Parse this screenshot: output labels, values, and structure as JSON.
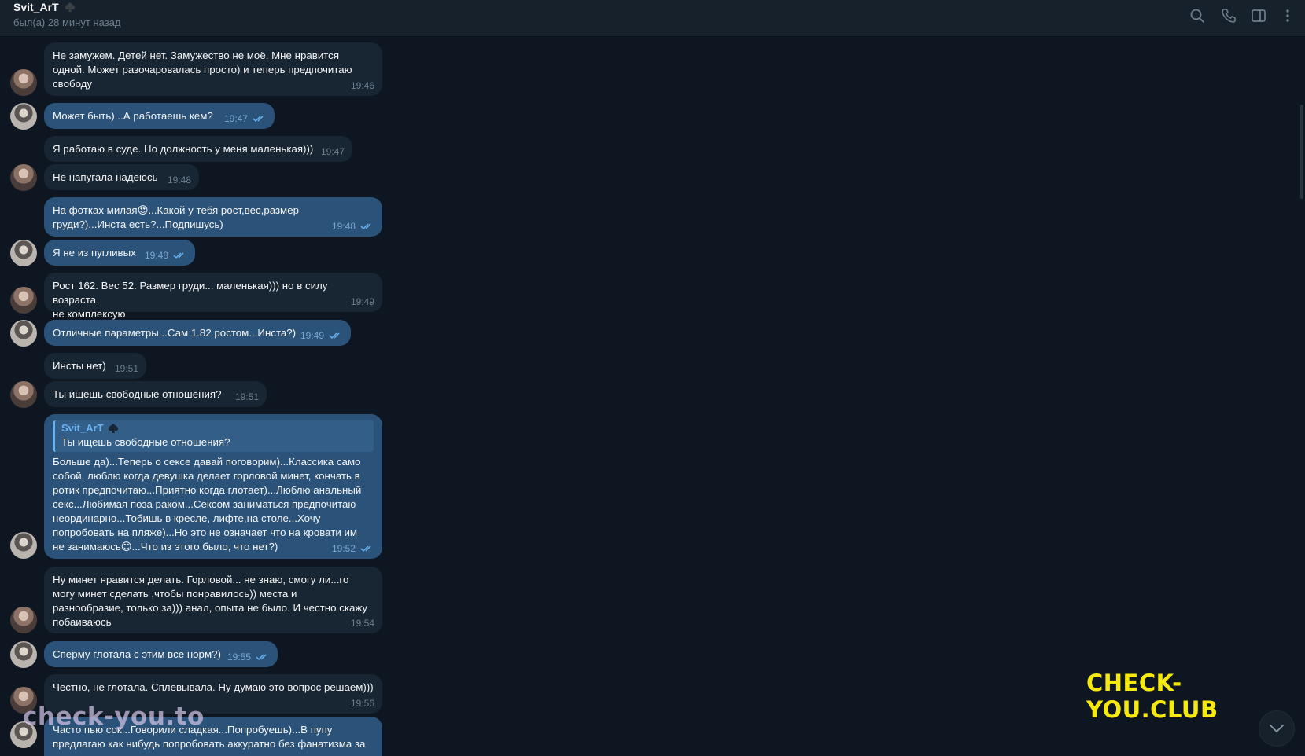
{
  "header": {
    "title": "Svit_ArT",
    "status": "был(а) 28 минут назад"
  },
  "messages": [
    {
      "dir": "in",
      "text": "Не замужем.  Детей нет. Замужество не моё. Мне нравится\nодной. Может разочаровалась просто) и теперь предпочитаю\nсвободу",
      "time": "19:46"
    },
    {
      "dir": "out",
      "text": "Может быть)...А работаешь кем?",
      "time": "19:47"
    },
    {
      "dir": "in",
      "text": "Я работаю в суде. Но должность у меня маленькая)))",
      "time": "19:47"
    },
    {
      "dir": "in",
      "text": "Не напугала надеюсь",
      "time": "19:48"
    },
    {
      "dir": "out",
      "text": "На фотках милая😍...Какой у тебя рост,вес,размер\nгруди?)...Инста есть?...Подпишусь)",
      "time": "19:48"
    },
    {
      "dir": "out",
      "text": "Я не из пугливых",
      "time": "19:48"
    },
    {
      "dir": "in",
      "text": "Рост 162. Вес 52. Размер груди... маленькая))) но в силу возраста\nне комплексую",
      "time": "19:49"
    },
    {
      "dir": "out",
      "text": "Отличные параметры...Сам 1.82 ростом...Инста?)",
      "time": "19:49"
    },
    {
      "dir": "in",
      "text": "Инсты нет)",
      "time": "19:51"
    },
    {
      "dir": "in",
      "text": "Ты ищешь свободные отношения?",
      "time": "19:51"
    },
    {
      "dir": "out",
      "reply_name": "Svit_ArT",
      "reply_text": "Ты ищешь свободные отношения?",
      "text": "Больше да)...Теперь о сексе давай поговорим)...Классика само\nсобой, люблю когда девушка делает горловой минет, кончать в\nротик предпочитаю...Приятно когда глотает)...Люблю анальный\nсекс...Любимая поза раком...Сексом заниматься предпочитаю\nнеординарно...Тобишь в кресле, лифте,на столе...Хочу\nпопробовать на пляже)...Но это не означает что на кровати им\nне занимаюсь😊...Что из этого было, что нет?)",
      "time": "19:52"
    },
    {
      "dir": "in",
      "text": "Ну минет нравится делать.  Горловой... не знаю,  смогу ли...го\nмогу минет сделать  ,чтобы понравилось)) места и\nразнообразие, только за))) анал, опыта не было. И честно скажу\nпобаиваюсь",
      "time": "19:54"
    },
    {
      "dir": "out",
      "text": "Сперму глотала с этим все норм?)",
      "time": "19:55"
    },
    {
      "dir": "in",
      "text": "Честно, не глотала. Сплевывала. Ну думаю это вопрос решаем)))",
      "time": "19:56"
    },
    {
      "dir": "out",
      "text": "Часто пью сок...Говорили сладкая...Попробуешь)...В пупу\nпредлагаю как нибудь попробовать аккуратно без фанатизма за",
      "time": ""
    }
  ],
  "watermarks": {
    "site1": "CHECK-YOU.CLUB",
    "site2": "check-you.to"
  },
  "icons": [
    "search-icon",
    "phone-icon",
    "sidebar-toggle-icon",
    "more-vert-icon",
    "read-check-icon",
    "scroll-down-icon",
    "spade-icon"
  ]
}
